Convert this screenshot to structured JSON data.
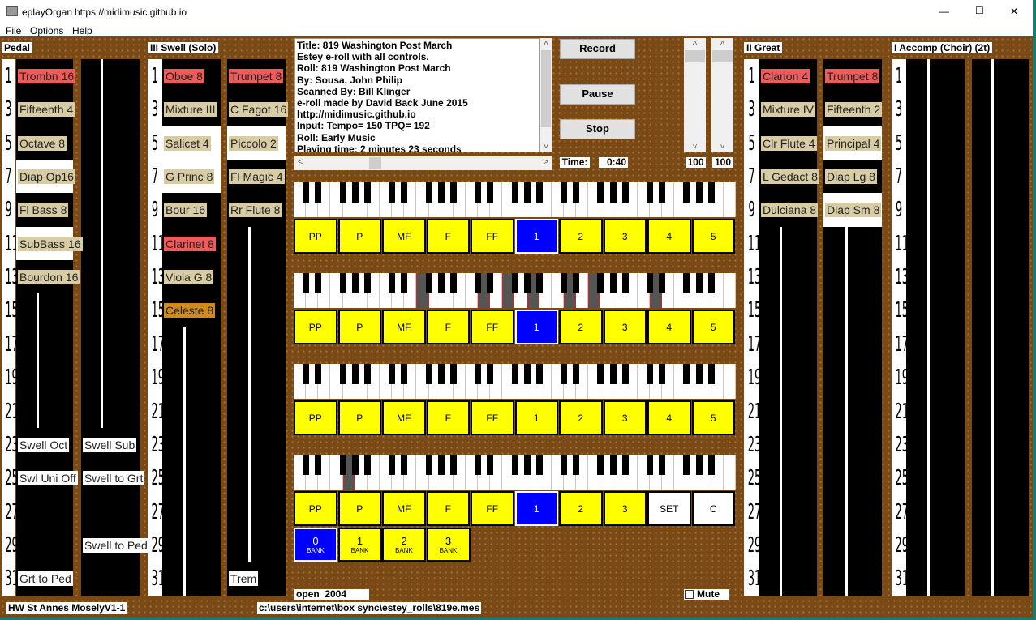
{
  "window": {
    "app_name": "eplayOrgan",
    "url": "https://midimusic.github.io",
    "minimize": "—",
    "maximize": "☐",
    "close": "✕"
  },
  "menu": [
    "File",
    "Options",
    "Help"
  ],
  "colors": {
    "stop_on": "#f05a5a",
    "stop_off": "#d8cca4",
    "stop_orange": "#d08a1e",
    "coupler": "#ffffff",
    "selected": "#0000ff",
    "preset": "#ffff00",
    "pressed_key": "#555555",
    "pressed_outline": "#d02020"
  },
  "row_numbers": [
    "1",
    "3",
    "5",
    "7",
    "9",
    "11",
    "13",
    "15",
    "17",
    "19",
    "21",
    "23",
    "25",
    "27",
    "29",
    "31"
  ],
  "divisions": [
    {
      "title": "Pedal",
      "columns": [
        {
          "white_rows": [
            3,
            5
          ],
          "stops": [
            {
              "row": 0,
              "label": "Trombn 16",
              "state": "on"
            },
            {
              "row": 1,
              "label": "Fifteenth 4",
              "state": "off"
            },
            {
              "row": 2,
              "label": "Octave 8",
              "state": "off"
            },
            {
              "row": 3,
              "label": "Diap Op16",
              "state": "off"
            },
            {
              "row": 4,
              "label": "Fl Bass 8",
              "state": "off"
            },
            {
              "row": 5,
              "label": "SubBass 16",
              "state": "off"
            },
            {
              "row": 6,
              "label": "Bourdon 16",
              "state": "off"
            },
            {
              "row": 11,
              "label": "Swell Oct",
              "state": "coupler"
            },
            {
              "row": 12,
              "label": "Swl Uni Off",
              "state": "coupler"
            },
            {
              "row": 15,
              "label": "Grt to Ped",
              "state": "coupler"
            }
          ]
        },
        {
          "white_rows": [],
          "stops": [
            {
              "row": 11,
              "label": "Swell Sub",
              "state": "coupler"
            },
            {
              "row": 12,
              "label": "Swell to Grt",
              "state": "coupler"
            },
            {
              "row": 14,
              "label": "Swell to Ped",
              "state": "coupler"
            }
          ]
        }
      ]
    },
    {
      "title": "III Swell (Solo)",
      "columns": [
        {
          "white_rows": [
            2,
            3
          ],
          "stops": [
            {
              "row": 0,
              "label": "Oboe 8",
              "state": "on"
            },
            {
              "row": 1,
              "label": "Mixture III",
              "state": "off"
            },
            {
              "row": 2,
              "label": "Salicet 4",
              "state": "off"
            },
            {
              "row": 3,
              "label": "G Princ 8",
              "state": "off"
            },
            {
              "row": 4,
              "label": "Bour 16",
              "state": "off"
            },
            {
              "row": 5,
              "label": "Clarinet 8",
              "state": "on"
            },
            {
              "row": 6,
              "label": "Viola G 8",
              "state": "off"
            },
            {
              "row": 7,
              "label": "Celeste 8",
              "state": "orange"
            }
          ]
        },
        {
          "white_rows": [
            2
          ],
          "stops": [
            {
              "row": 0,
              "label": "Trumpet 8",
              "state": "on"
            },
            {
              "row": 1,
              "label": "C Fagot 16",
              "state": "off"
            },
            {
              "row": 2,
              "label": "Piccolo 2",
              "state": "off"
            },
            {
              "row": 3,
              "label": "Fl Magic 4",
              "state": "off"
            },
            {
              "row": 4,
              "label": "Rr Flute 8",
              "state": "off"
            },
            {
              "row": 15,
              "label": "Trem",
              "state": "coupler"
            }
          ]
        }
      ]
    },
    {
      "title": "II Great",
      "columns": [
        {
          "white_rows": [],
          "stops": [
            {
              "row": 0,
              "label": "Clarion 4",
              "state": "on"
            },
            {
              "row": 1,
              "label": "Mixture IV",
              "state": "off"
            },
            {
              "row": 2,
              "label": "Clr Flute 4",
              "state": "off"
            },
            {
              "row": 3,
              "label": "L Gedact 8",
              "state": "off"
            },
            {
              "row": 4,
              "label": "Dulciana 8",
              "state": "off"
            }
          ]
        },
        {
          "white_rows": [
            2,
            4
          ],
          "stops": [
            {
              "row": 0,
              "label": "Trumpet 8",
              "state": "on"
            },
            {
              "row": 1,
              "label": "Fifteenth 2",
              "state": "off"
            },
            {
              "row": 2,
              "label": "Principal 4",
              "state": "off"
            },
            {
              "row": 3,
              "label": "Diap Lg 8",
              "state": "off"
            },
            {
              "row": 4,
              "label": "Diap Sm 8",
              "state": "off"
            }
          ]
        }
      ]
    },
    {
      "title": "I Accomp (Choir) (2t)",
      "columns": [
        {
          "white_rows": [],
          "stops": []
        },
        {
          "white_rows": [],
          "stops": []
        }
      ]
    }
  ],
  "info_text": [
    "Title: 819  Washington Post March",
    "Estey e-roll with all controls.",
    "Roll: 819  Washington Post March",
    "By:  Sousa, John Philip",
    "Scanned By: Bill Klinger",
    "e-roll made by David Back June 2015",
    "http://midimusic.github.io",
    "Input: Tempo= 150 TPQ= 192",
    "Roll: Early Music",
    "Playing time: 2 minutes 23 seconds"
  ],
  "transport": {
    "record": "Record",
    "pause": "Pause",
    "stop": "Stop",
    "time_label": "Time:",
    "time_value": "0:40"
  },
  "volumes": [
    "100",
    "100"
  ],
  "keyboards": [
    {
      "pressed_white": [],
      "buttons": [
        {
          "label": "PP"
        },
        {
          "label": "P"
        },
        {
          "label": "MF"
        },
        {
          "label": "F"
        },
        {
          "label": "FF"
        },
        {
          "label": "1",
          "selected": true
        },
        {
          "label": "2"
        },
        {
          "label": "3"
        },
        {
          "label": "4"
        },
        {
          "label": "5"
        }
      ]
    },
    {
      "pressed_white": [
        10,
        15,
        17,
        19,
        22,
        24,
        29
      ],
      "buttons": [
        {
          "label": "PP"
        },
        {
          "label": "P"
        },
        {
          "label": "MF"
        },
        {
          "label": "F"
        },
        {
          "label": "FF"
        },
        {
          "label": "1",
          "selected": true
        },
        {
          "label": "2"
        },
        {
          "label": "3"
        },
        {
          "label": "4"
        },
        {
          "label": "5"
        }
      ]
    },
    {
      "pressed_white": [],
      "buttons": [
        {
          "label": "PP"
        },
        {
          "label": "P"
        },
        {
          "label": "MF"
        },
        {
          "label": "F"
        },
        {
          "label": "FF"
        },
        {
          "label": "1"
        },
        {
          "label": "2"
        },
        {
          "label": "3"
        },
        {
          "label": "4"
        },
        {
          "label": "5"
        }
      ]
    },
    {
      "pressed_white": [
        4
      ],
      "buttons": [
        {
          "label": "PP"
        },
        {
          "label": "P"
        },
        {
          "label": "MF"
        },
        {
          "label": "F"
        },
        {
          "label": "FF"
        },
        {
          "label": "1",
          "selected": true
        },
        {
          "label": "2"
        },
        {
          "label": "3"
        },
        {
          "label": "SET",
          "white": true
        },
        {
          "label": "C",
          "white": true
        }
      ]
    }
  ],
  "banks": [
    {
      "label": "0",
      "sub": "BANK",
      "selected": true
    },
    {
      "label": "1",
      "sub": "BANK"
    },
    {
      "label": "2",
      "sub": "BANK"
    },
    {
      "label": "3",
      "sub": "BANK"
    }
  ],
  "status": {
    "open_text": "open  2004",
    "mute_label": "Mute",
    "organ_name": "HW St Annes MoselyV1-1",
    "file_path": "c:\\users\\internet\\box sync\\estey_rolls\\819e.mes"
  }
}
